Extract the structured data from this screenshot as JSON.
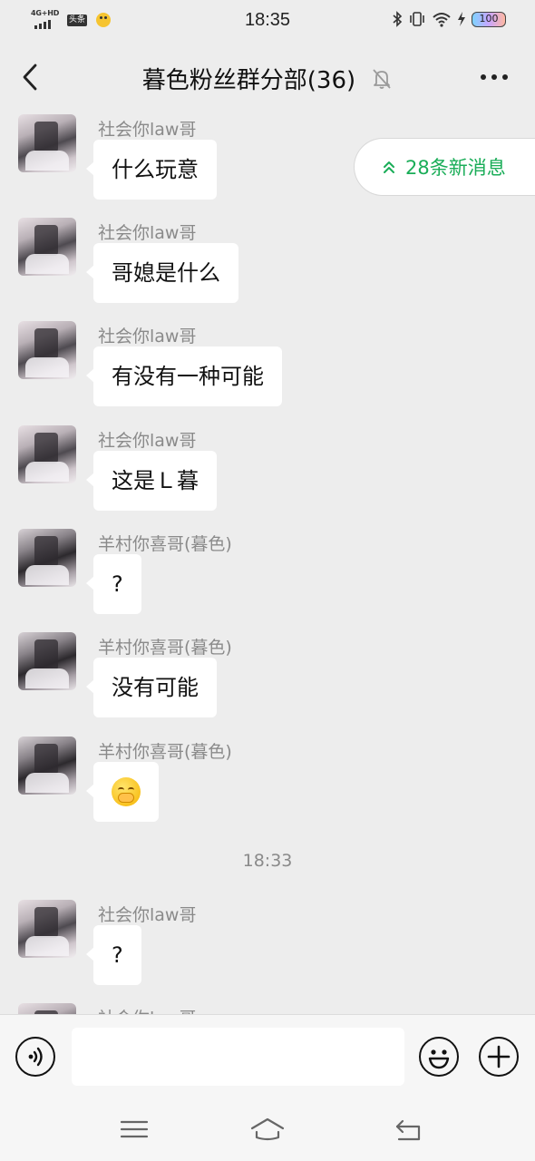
{
  "status_bar": {
    "network": "4G+HD",
    "badge": "头条",
    "time": "18:35",
    "battery": "100"
  },
  "header": {
    "title": "暮色粉丝群分部(36)"
  },
  "new_messages_pill": {
    "label": "28条新消息"
  },
  "messages": [
    {
      "sender": "社会你law哥",
      "text": "什么玩意"
    },
    {
      "sender": "社会你law哥",
      "text": "哥媳是什么"
    },
    {
      "sender": "社会你law哥",
      "text": "有没有一种可能"
    },
    {
      "sender": "社会你law哥",
      "text": "这是Ｌ暮"
    },
    {
      "sender": "羊村你喜哥(暮色)",
      "text": "?"
    },
    {
      "sender": "羊村你喜哥(暮色)",
      "text": "没有可能"
    },
    {
      "sender": "羊村你喜哥(暮色)",
      "text": "",
      "emoji": "hand-over-mouth-emoji"
    },
    {
      "sender": "社会你law哥",
      "text": "?"
    },
    {
      "sender": "社会你law哥",
      "text": ""
    }
  ],
  "time_divider": "18:33",
  "input": {
    "placeholder": "",
    "value": ""
  },
  "icons": {
    "back": "chevron-left-icon",
    "mute": "bell-off-icon",
    "more": "ellipsis-icon",
    "voice": "voice-icon",
    "emoji": "smiley-icon",
    "plus": "plus-icon"
  },
  "colors": {
    "background": "#ededed",
    "bubble": "#ffffff",
    "accent_green": "#1aad58",
    "sender_gray": "#8a8a8a"
  }
}
